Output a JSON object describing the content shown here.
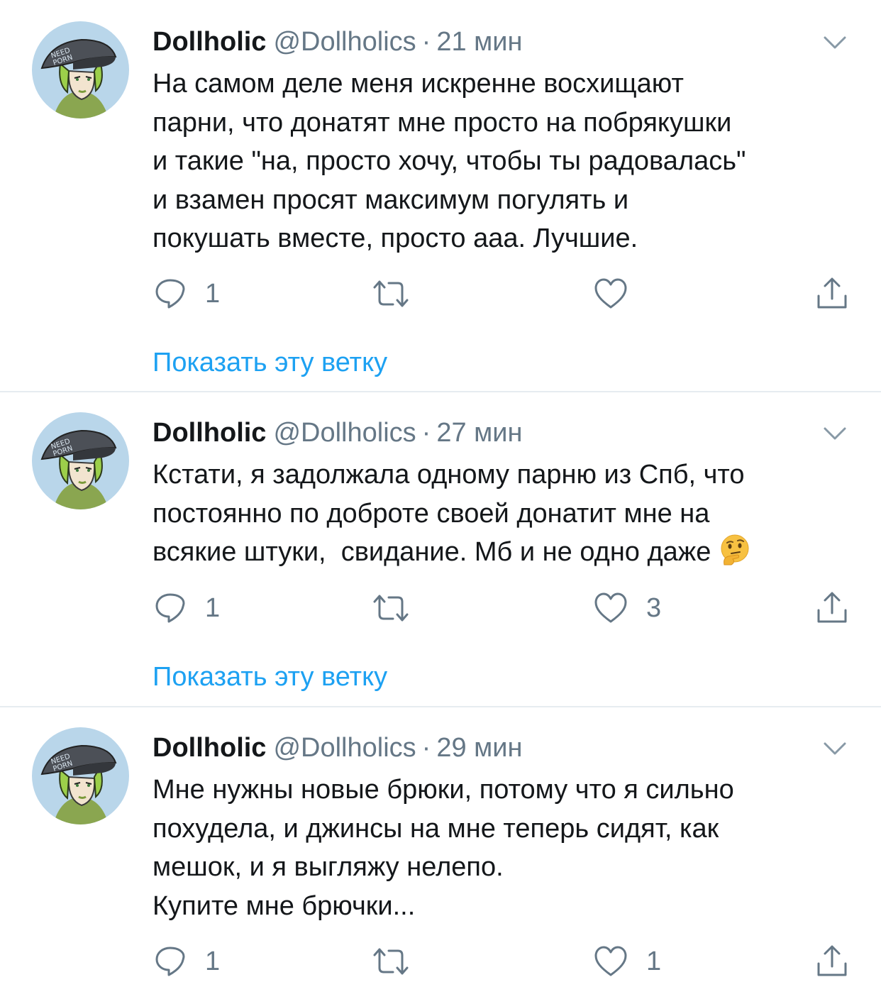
{
  "colors": {
    "text": "#14171a",
    "secondary": "#657786",
    "link": "#1da1f2",
    "divider": "#e6ecf0",
    "avatar_bg": "#b7d4e8"
  },
  "icons": {
    "reply": "reply-icon",
    "retweet": "retweet-icon",
    "like": "like-icon",
    "share": "share-icon",
    "caret": "chevron-down-icon"
  },
  "tweets": [
    {
      "display_name": "Dollholic",
      "handle": "@Dollholics",
      "separator": "·",
      "time": "21 мин",
      "text": "На самом деле меня искренне восхищают\nпарни, что донатят мне просто на побрякушки\nи такие \"на, просто хочу, чтобы ты радовалась\"\nи взамен просят максимум погулять и\nпокушать вместе, просто ааа. Лучшие.",
      "reply_count": "1",
      "retweet_count": "",
      "like_count": "",
      "show_thread": "Показать эту ветку"
    },
    {
      "display_name": "Dollholic",
      "handle": "@Dollholics",
      "separator": "·",
      "time": "27 мин",
      "text": "Кстати, я задолжала одному парню из Спб, что\nпостоянно по доброте своей донатит мне на\nвсякие штуки,  свидание. Мб и не одно даже ",
      "emoji": "thinking-face-emoji",
      "reply_count": "1",
      "retweet_count": "",
      "like_count": "3",
      "show_thread": "Показать эту ветку"
    },
    {
      "display_name": "Dollholic",
      "handle": "@Dollholics",
      "separator": "·",
      "time": "29 мин",
      "text": "Мне нужны новые брюки, потому что я сильно\nпохудела, и джинсы на мне теперь сидят, как\nмешок, и я выгляжу нелепо.\nКупите мне брючки...",
      "reply_count": "1",
      "retweet_count": "",
      "like_count": "1"
    }
  ]
}
